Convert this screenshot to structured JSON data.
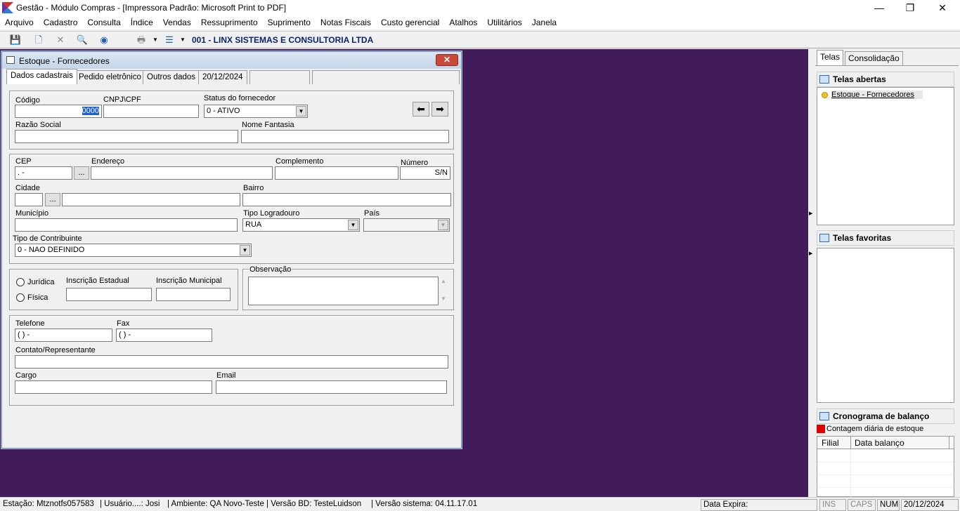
{
  "window": {
    "title": "Gestão  - Módulo Compras - [Impressora Padrão: Microsoft Print to PDF]",
    "minimize": "—",
    "maximize": "❐",
    "close": "✕"
  },
  "menu": [
    "Arquivo",
    "Cadastro",
    "Consulta",
    "Índice",
    "Vendas",
    "Ressuprimento",
    "Suprimento",
    "Notas Fiscais",
    "Custo gerencial",
    "Atalhos",
    "Utilitários",
    "Janela"
  ],
  "toolbar": {
    "company": "001 - LINX SISTEMAS E CONSULTORIA LTDA"
  },
  "child": {
    "title": "Estoque - Fornecedores",
    "close": "✕",
    "tabs": [
      "Dados cadastrais",
      "Pedido eletrônico",
      "Outros dados",
      "20/12/2024"
    ],
    "labels": {
      "codigo": "Código",
      "cnpj": "CNPJ\\CPF",
      "status": "Status do fornecedor",
      "razao": "Razão Social",
      "fantasia": "Nome Fantasia",
      "cep": "CEP",
      "endereco": "Endereço",
      "complemento": "Complemento",
      "numero": "Número",
      "cidade": "Cidade",
      "bairro": "Bairro",
      "municipio": "Município",
      "tipo_logradouro": "Tipo Logradouro",
      "pais": "País",
      "tipo_contribuinte": "Tipo de Contribuinte",
      "juridica": "Jurídica",
      "fisica": "Física",
      "insc_estadual": "Inscrição Estadual",
      "insc_municipal": "Inscrição Municipal",
      "observacao": "Observação",
      "telefone": "Telefone",
      "fax": "Fax",
      "contato": "Contato/Representante",
      "cargo": "Cargo",
      "email": "Email"
    },
    "values": {
      "codigo": "0000",
      "status": "0 - ATIVO",
      "cep": " .   -",
      "numero": "S/N",
      "tipo_logradouro": "RUA",
      "tipo_contribuinte": "0 - NAO DEFINIDO",
      "telefone": "(  )    -",
      "fax": "(  )    -",
      "lookup": "..."
    }
  },
  "right": {
    "tabs": [
      "Telas",
      "Consolidação"
    ],
    "open_title": "Telas abertas",
    "open_items": [
      "Estoque - Fornecedores"
    ],
    "fav_title": "Telas favoritas",
    "crono_title": "Cronograma de balanço",
    "legend": "Contagem diária de estoque",
    "columns": [
      "Filial",
      "Data balanço"
    ]
  },
  "status": {
    "estacao": "Estação: Mtznotfs057583",
    "usuario": "| Usuário....: Josi",
    "ambiente": "| Ambiente: QA Novo-Teste | Versão BD: TesteLuidson",
    "versao": "| Versão sistema: 04.11.17.01",
    "data_expira": "Data Expira:",
    "ins": "INS",
    "caps": "CAPS",
    "num": "NUM",
    "date": "20/12/2024"
  },
  "colors": {
    "desktop": "#421c5a",
    "accent": "#0a246a"
  }
}
